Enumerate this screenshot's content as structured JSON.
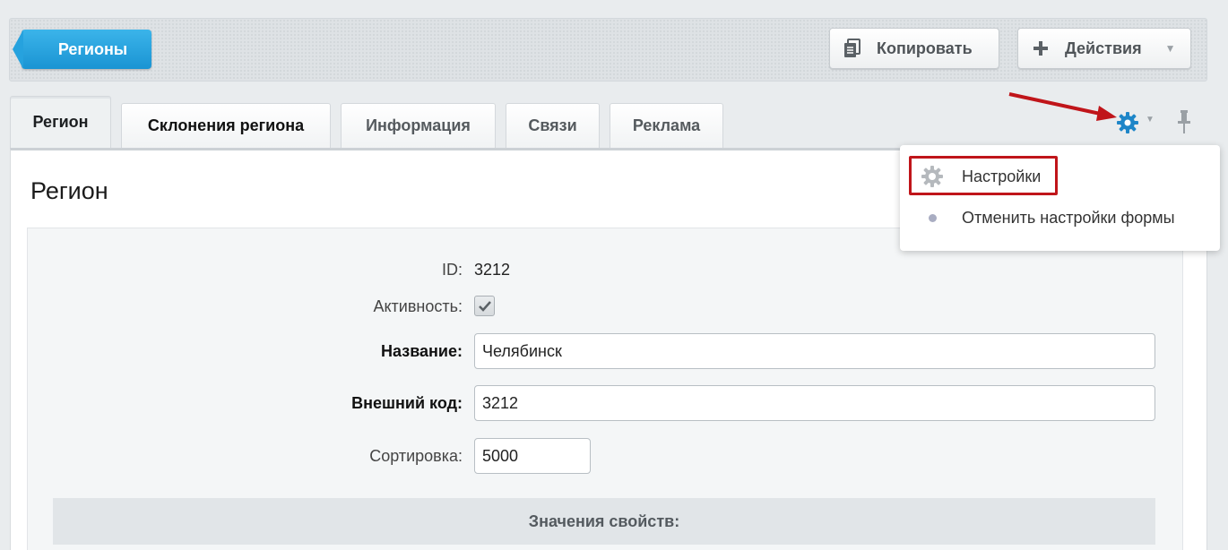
{
  "toolbar": {
    "back_label": "Регионы",
    "copy_label": "Копировать",
    "actions_label": "Действия"
  },
  "tabs": [
    {
      "label": "Регион"
    },
    {
      "label": "Склонения региона"
    },
    {
      "label": "Информация"
    },
    {
      "label": "Связи"
    },
    {
      "label": "Реклама"
    }
  ],
  "section": {
    "title": "Регион"
  },
  "form": {
    "id_label": "ID:",
    "id_value": "3212",
    "active_label": "Активность:",
    "active_checked": true,
    "name_label": "Название:",
    "name_value": "Челябинск",
    "ext_code_label": "Внешний код:",
    "ext_code_value": "3212",
    "sort_label": "Сортировка:",
    "sort_value": "5000",
    "props_header": "Значения свойств:"
  },
  "menu": {
    "items": [
      {
        "label": "Настройки",
        "icon": "gear-icon"
      },
      {
        "label": "Отменить настройки формы",
        "icon": "dot-icon"
      }
    ]
  },
  "colors": {
    "accent": "#1a94d3",
    "highlight": "#c0151a",
    "gear": "#1e86c8"
  }
}
